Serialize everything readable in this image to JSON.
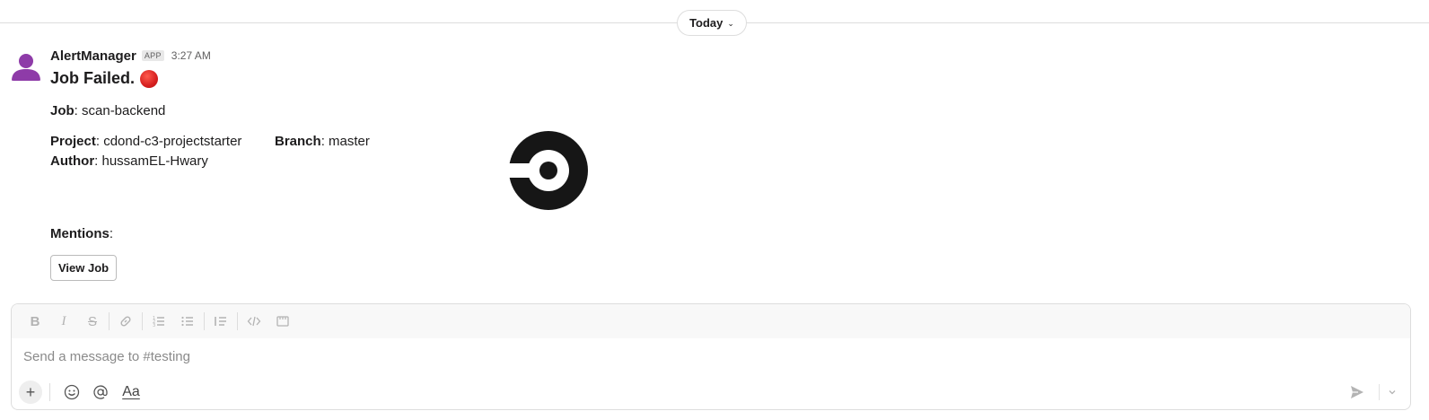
{
  "divider": {
    "label": "Today",
    "chevron_icon": "chevron-down-icon"
  },
  "message": {
    "sender": "AlertManager",
    "badge": "APP",
    "time": "3:27 AM",
    "title": "Job Failed.",
    "title_emoji": "red-circle-icon",
    "job_label": "Job",
    "job_value": ": scan-backend",
    "project_label": "Project",
    "project_value": ": cdond-c3-projectstarter",
    "branch_label": "Branch",
    "branch_value": ": master",
    "author_label": "Author",
    "author_value": ": hussamEL-Hwary",
    "mentions_label": "Mentions",
    "mentions_value": ":",
    "button_label": "View Job",
    "image": "circleci-logo"
  },
  "composer": {
    "placeholder": "Send a message to #testing",
    "format_buttons": [
      "bold-icon",
      "italic-icon",
      "strikethrough-icon",
      "link-icon",
      "ordered-list-icon",
      "bulleted-list-icon",
      "blockquote-icon",
      "code-icon",
      "code-block-icon"
    ],
    "format_glyphs": {
      "bold": "B",
      "italic": "I",
      "strike": "S"
    },
    "aa_label": "Aa",
    "plus_glyph": "+"
  },
  "colors": {
    "accent_red": "#d61f1f",
    "avatar_purple": "#8e3ba8",
    "logo": "#161616"
  }
}
